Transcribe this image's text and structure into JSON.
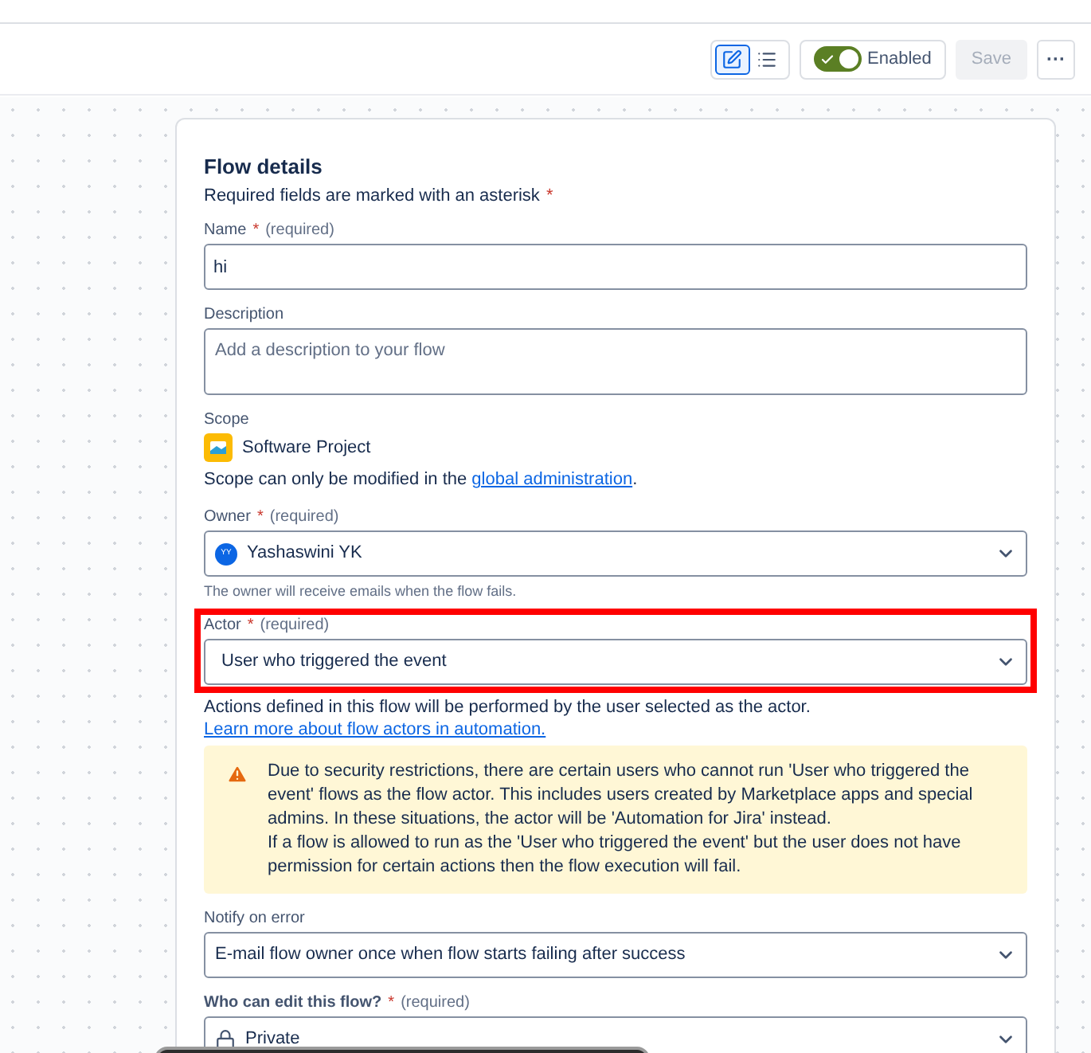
{
  "toolbar": {
    "view_toggles": [
      {
        "kind": "edit",
        "selected": true
      },
      {
        "kind": "checklist",
        "selected": false
      }
    ],
    "enabled_toggle": {
      "label": "Enabled",
      "on": true
    },
    "save_button": {
      "label": "Save",
      "disabled": true
    },
    "more_button": {
      "label": "···"
    }
  },
  "card": {
    "title": "Flow details",
    "subtitle": "Required fields are marked with an asterisk",
    "subtitle_mark": "*",
    "fields": [
      {
        "kind": "text",
        "label": "Name",
        "required_mark": "*",
        "required_note": "(required)",
        "value": "hi"
      },
      {
        "kind": "textarea",
        "label": "Description",
        "placeholder": "Add a description to your flow"
      },
      {
        "kind": "scope",
        "label": "Scope",
        "value": "Software Project",
        "note": "Scope can only be modified in the",
        "link": "global administration",
        "note_end": "."
      },
      {
        "kind": "select",
        "label": "Owner",
        "required_mark": "*",
        "required_note": "(required)",
        "value": "Yashaswini YK",
        "avatar": "YY",
        "helper": "The owner will receive emails when the flow fails."
      },
      {
        "kind": "select",
        "label": "Actor",
        "required_mark": "*",
        "required_note": "(required)",
        "value": "User who triggered the event",
        "highlighted": true,
        "note": "Actions defined in this flow will be performed by the user selected as the actor.",
        "link": "Learn more about flow actors in automation.",
        "warning": [
          "Due to security restrictions, there are certain users who cannot run 'User who triggered the event' flows as the flow actor. This includes users created by Marketplace apps and special admins. In these situations, the actor will be 'Automation for Jira' instead.",
          "If a flow is allowed to run as the 'User who triggered the event' but the user does not have permission for certain actions then the flow execution will fail."
        ]
      },
      {
        "kind": "select",
        "label": "Notify on error",
        "value": "E-mail flow owner once when flow starts failing after success"
      },
      {
        "kind": "select",
        "label": "Who can edit this flow?",
        "required_mark": "*",
        "required_note": "(required)",
        "value": "Private",
        "lock": true
      }
    ]
  }
}
